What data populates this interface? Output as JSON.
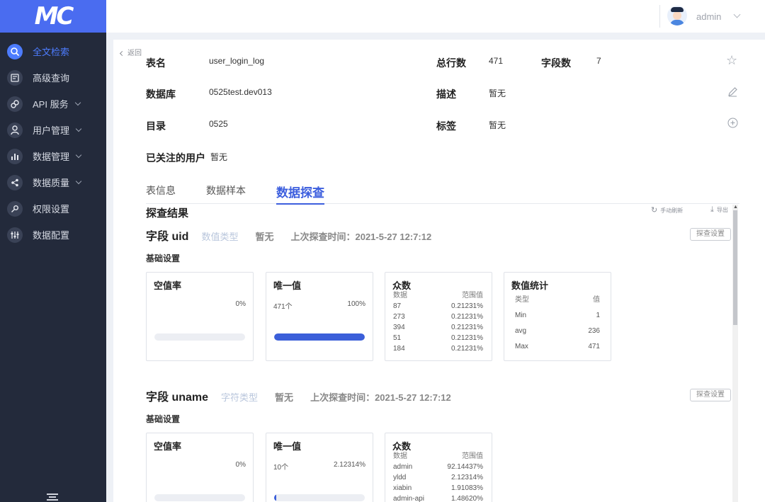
{
  "app": {
    "logo": "MC"
  },
  "sidebar": {
    "items": [
      {
        "label": "全文检索",
        "icon": "search-icon",
        "active": true,
        "has_children": false
      },
      {
        "label": "高级查询",
        "icon": "query-icon",
        "active": false,
        "has_children": false
      },
      {
        "label": "API 服务",
        "icon": "link-icon",
        "active": false,
        "has_children": true
      },
      {
        "label": "用户管理",
        "icon": "user-icon",
        "active": false,
        "has_children": true
      },
      {
        "label": "数据管理",
        "icon": "bar-chart-icon",
        "active": false,
        "has_children": true
      },
      {
        "label": "数据质量",
        "icon": "share-icon",
        "active": false,
        "has_children": true
      },
      {
        "label": "权限设置",
        "icon": "key-icon",
        "active": false,
        "has_children": false
      },
      {
        "label": "数据配置",
        "icon": "sliders-icon",
        "active": false,
        "has_children": false
      }
    ]
  },
  "topbar": {
    "username": "admin"
  },
  "page": {
    "back_label": "返回",
    "info": {
      "table_name_label": "表名",
      "table_name": "user_login_log",
      "row_count_label": "总行数",
      "row_count": "471",
      "field_count_label": "字段数",
      "field_count": "7",
      "database_label": "数据库",
      "database": "0525test.dev013",
      "description_label": "描述",
      "description": "暂无",
      "catalog_label": "目录",
      "catalog": "0525",
      "tags_label": "标签",
      "tags": "暂无",
      "followers_label": "已关注的用户",
      "followers": "暂无"
    },
    "tabs": [
      {
        "label": "表信息",
        "active": false
      },
      {
        "label": "数据样本",
        "active": false
      },
      {
        "label": "数据探查",
        "active": true
      }
    ],
    "section_title": "探查结果",
    "refresh_label": "手动刷新",
    "export_label": "导出",
    "fields": [
      {
        "name": "字段 uid",
        "type": "数值类型",
        "desc": "暂无",
        "last_probe": "上次探查时间：2021-5-27 12:7:12",
        "probe_settings": "探查设置",
        "basic_label": "基础设置",
        "null_rate": {
          "title": "空值率",
          "value": "0%",
          "fraction": 0.0
        },
        "unique": {
          "title": "唯一值",
          "count": "471个",
          "value": "100%",
          "fraction": 1.0
        },
        "mode": {
          "title": "众数",
          "col_data": "数据",
          "col_range": "范围值",
          "rows": [
            {
              "data": "87",
              "range": "0.21231%"
            },
            {
              "data": "273",
              "range": "0.21231%"
            },
            {
              "data": "394",
              "range": "0.21231%"
            },
            {
              "data": "51",
              "range": "0.21231%"
            },
            {
              "data": "184",
              "range": "0.21231%"
            }
          ]
        },
        "stats": {
          "title": "数值统计",
          "col_type": "类型",
          "col_value": "值",
          "rows": [
            {
              "type": "Min",
              "value": "1"
            },
            {
              "type": "avg",
              "value": "236"
            },
            {
              "type": "Max",
              "value": "471"
            }
          ]
        }
      },
      {
        "name": "字段 uname",
        "type": "字符类型",
        "desc": "暂无",
        "last_probe": "上次探查时间：2021-5-27 12:7:12",
        "probe_settings": "探查设置",
        "basic_label": "基础设置",
        "null_rate": {
          "title": "空值率",
          "value": "0%",
          "fraction": 0.0
        },
        "unique": {
          "title": "唯一值",
          "count": "10个",
          "value": "2.12314%",
          "fraction": 0.021
        },
        "mode": {
          "title": "众数",
          "col_data": "数据",
          "col_range": "范围值",
          "rows": [
            {
              "data": "admin",
              "range": "92.14437%"
            },
            {
              "data": "yldd",
              "range": "2.12314%"
            },
            {
              "data": "xiabin",
              "range": "1.91083%"
            },
            {
              "data": "admin-api",
              "range": "1.48620%"
            }
          ]
        }
      }
    ]
  },
  "colors": {
    "accent": "#3d5fde",
    "sidebar_bg": "#232a3b",
    "logo_bg": "#4a6cf0"
  }
}
